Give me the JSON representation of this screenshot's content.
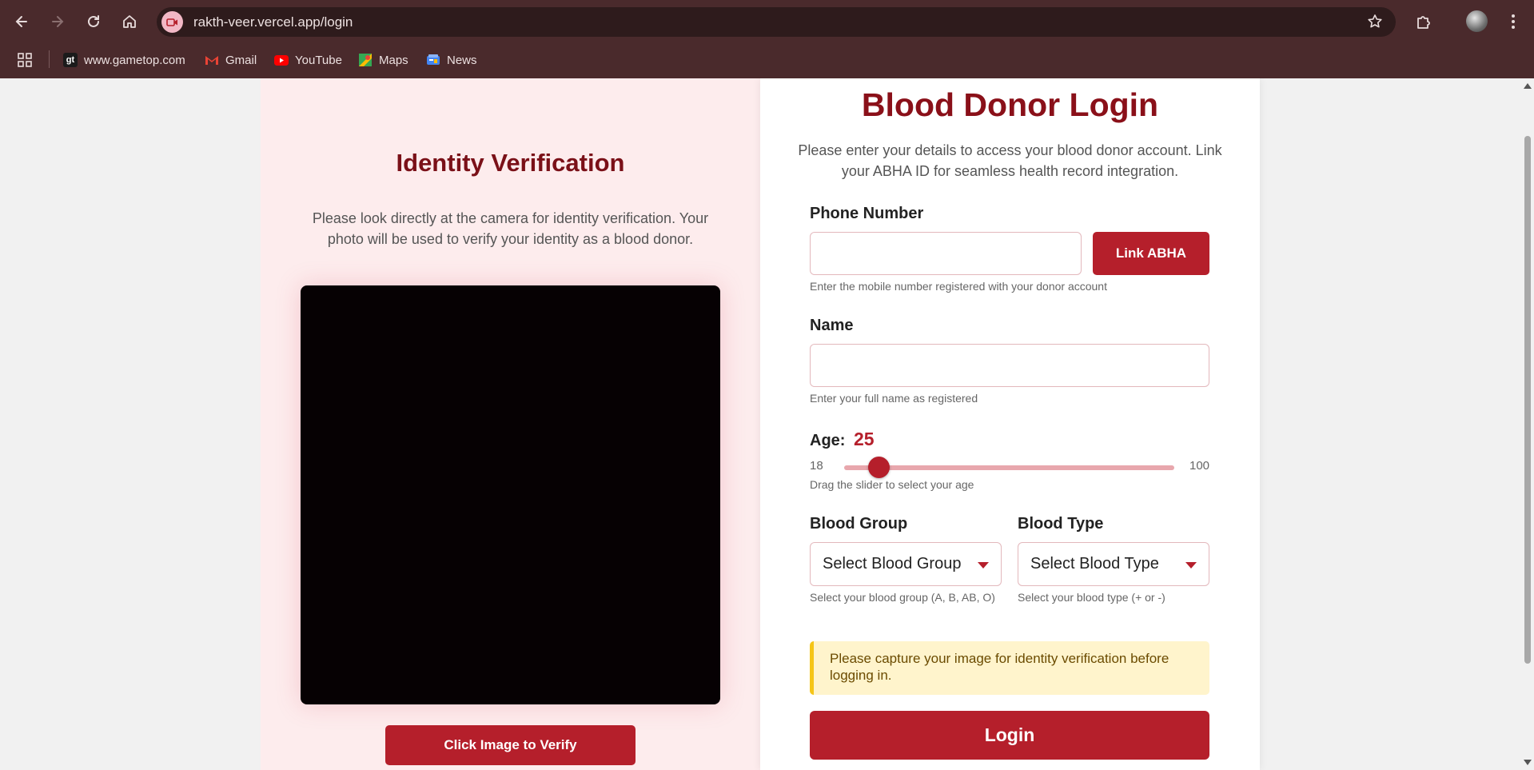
{
  "browser": {
    "url": "rakth-veer.vercel.app/login",
    "bookmarks": [
      {
        "label": "www.gametop.com",
        "icon": "gametop-icon"
      },
      {
        "label": "Gmail",
        "icon": "gmail-icon"
      },
      {
        "label": "YouTube",
        "icon": "youtube-icon"
      },
      {
        "label": "Maps",
        "icon": "maps-icon"
      },
      {
        "label": "News",
        "icon": "news-icon"
      }
    ]
  },
  "identity": {
    "title": "Identity Verification",
    "description": "Please look directly at the camera for identity verification. Your photo will be used to verify your identity as a blood donor.",
    "verify_button": "Click Image to Verify"
  },
  "login": {
    "title": "Blood Donor Login",
    "description": "Please enter your details to access your blood donor account. Link your ABHA ID for seamless health record integration.",
    "phone": {
      "label": "Phone Number",
      "value": "",
      "hint": "Enter the mobile number registered with your donor account",
      "link_button": "Link ABHA"
    },
    "name": {
      "label": "Name",
      "value": "",
      "hint": "Enter your full name as registered"
    },
    "age": {
      "label": "Age:",
      "value": "25",
      "min": "18",
      "max": "100",
      "hint": "Drag the slider to select your age"
    },
    "blood_group": {
      "label": "Blood Group",
      "selected": "Select Blood Group",
      "hint": "Select your blood group (A, B, AB, O)"
    },
    "blood_type": {
      "label": "Blood Type",
      "selected": "Select Blood Type",
      "hint": "Select your blood type (+ or -)"
    },
    "alert": "Please capture your image for identity verification before logging in.",
    "login_button": "Login"
  },
  "colors": {
    "brand_red": "#b51f2b",
    "title_red": "#8a1019",
    "chrome_bg": "#4a2a2c",
    "left_panel_bg": "#fdeced",
    "alert_bg": "#fff4cc",
    "alert_border": "#f5c518"
  }
}
